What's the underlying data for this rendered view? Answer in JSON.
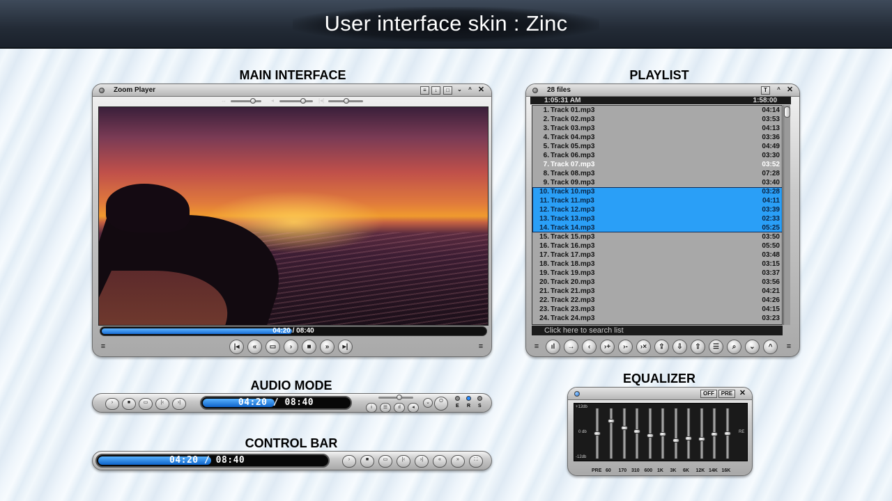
{
  "header": {
    "title": "User interface skin : Zinc"
  },
  "sections": {
    "main": "MAIN INTERFACE",
    "playlist": "PLAYLIST",
    "audio": "AUDIO MODE",
    "equalizer": "EQUALIZER",
    "control": "CONTROL BAR"
  },
  "main_window": {
    "title": "Zoom Player",
    "time": "04:20 / 08:40",
    "progress": 0.5
  },
  "playlist": {
    "count": "28 files",
    "time_left": "1:05:31 AM",
    "time_right": "1:58:00",
    "search_placeholder": "Click here to search list",
    "current_index": 7,
    "selected_range": [
      10,
      14
    ],
    "tracks": [
      {
        "n": "1.",
        "name": "Track 01.mp3",
        "dur": "04:14"
      },
      {
        "n": "2.",
        "name": "Track 02.mp3",
        "dur": "03:53"
      },
      {
        "n": "3.",
        "name": "Track 03.mp3",
        "dur": "04:13"
      },
      {
        "n": "4.",
        "name": "Track 04.mp3",
        "dur": "03:36"
      },
      {
        "n": "5.",
        "name": "Track 05.mp3",
        "dur": "04:49"
      },
      {
        "n": "6.",
        "name": "Track 06.mp3",
        "dur": "03:30"
      },
      {
        "n": "7.",
        "name": "Track 07.mp3",
        "dur": "03:52"
      },
      {
        "n": "8.",
        "name": "Track 08.mp3",
        "dur": "07:28"
      },
      {
        "n": "9.",
        "name": "Track 09.mp3",
        "dur": "03:40"
      },
      {
        "n": "10.",
        "name": "Track 10.mp3",
        "dur": "03:28"
      },
      {
        "n": "11.",
        "name": "Track 11.mp3",
        "dur": "04:11"
      },
      {
        "n": "12.",
        "name": "Track 12.mp3",
        "dur": "03:39"
      },
      {
        "n": "13.",
        "name": "Track 13.mp3",
        "dur": "02:33"
      },
      {
        "n": "14.",
        "name": "Track 14.mp3",
        "dur": "05:25"
      },
      {
        "n": "15.",
        "name": "Track 15.mp3",
        "dur": "03:50"
      },
      {
        "n": "16.",
        "name": "Track 16.mp3",
        "dur": "05:50"
      },
      {
        "n": "17.",
        "name": "Track 17.mp3",
        "dur": "03:48"
      },
      {
        "n": "18.",
        "name": "Track 18.mp3",
        "dur": "03:15"
      },
      {
        "n": "19.",
        "name": "Track 19.mp3",
        "dur": "03:37"
      },
      {
        "n": "20.",
        "name": "Track 20.mp3",
        "dur": "03:56"
      },
      {
        "n": "21.",
        "name": "Track 21.mp3",
        "dur": "04:21"
      },
      {
        "n": "22.",
        "name": "Track 22.mp3",
        "dur": "04:26"
      },
      {
        "n": "23.",
        "name": "Track 23.mp3",
        "dur": "04:15"
      },
      {
        "n": "24.",
        "name": "Track 24.mp3",
        "dur": "03:23"
      }
    ]
  },
  "audio_mode": {
    "time": "04:20 / 08:40",
    "progress": 0.5,
    "led_labels": [
      "E",
      "R",
      "S"
    ]
  },
  "control_bar": {
    "time": "04:20 / 08:40",
    "progress": 0.5
  },
  "equalizer": {
    "buttons": {
      "off": "OFF",
      "pre": "PRE"
    },
    "scale": {
      "top": "+12db",
      "mid": "0 db",
      "bottom": "-12db"
    },
    "bands": [
      "PRE",
      "60",
      "170",
      "310",
      "600",
      "1K",
      "3K",
      "6K",
      "12K",
      "14K",
      "16K"
    ],
    "levels": [
      0.5,
      0.78,
      0.62,
      0.55,
      0.45,
      0.48,
      0.35,
      0.4,
      0.38,
      0.48,
      0.5
    ],
    "re_label": "RE"
  }
}
